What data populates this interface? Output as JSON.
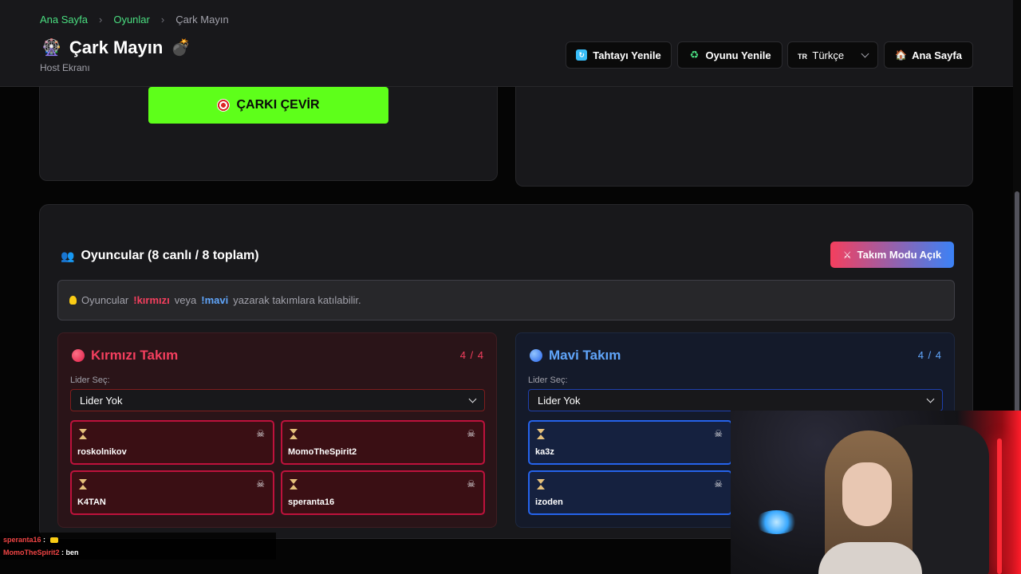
{
  "header": {
    "breadcrumb": {
      "home": "Ana Sayfa",
      "games": "Oyunlar",
      "current": "Çark Mayın"
    },
    "title": "Çark Mayın",
    "subtitle": "Host Ekranı",
    "buttons": {
      "refresh_board": "Tahtayı Yenile",
      "restart_game": "Oyunu Yenile",
      "language": "Türkçe",
      "language_code": "TR",
      "home": "Ana Sayfa"
    }
  },
  "wheel": {
    "spin_label": "ÇARKI ÇEVİR",
    "colors": {
      "left": "#2563eb",
      "right": "#b91c1c"
    }
  },
  "players": {
    "title": "Oyuncular (8 canlı / 8 toplam)",
    "team_mode_label": "Takım Modu Açık",
    "hint": {
      "prefix": "Oyuncular",
      "red_cmd": "!kırmızı",
      "mid": "veya",
      "blue_cmd": "!mavi",
      "suffix": "yazarak takımlara katılabilir."
    },
    "red_team": {
      "name": "Kırmızı Takım",
      "count": "4 / 4",
      "leader_label": "Lider Seç:",
      "leader_value": "Lider Yok",
      "members": [
        "roskolnikov",
        "MomoTheSpirit2",
        "K4TAN",
        "speranta16"
      ]
    },
    "blue_team": {
      "name": "Mavi Takım",
      "count": "4 / 4",
      "leader_label": "Lider Seç:",
      "leader_value": "Lider Yok",
      "members": [
        "ka3z",
        "izoden"
      ]
    }
  },
  "chat": [
    {
      "user": "speranta16",
      "message": ""
    },
    {
      "user": "MomoTheSpirit2",
      "message": "ben"
    }
  ],
  "accent_colors": {
    "green": "#4ade80",
    "spin": "#5eff1a",
    "red": "#f43f5e",
    "blue": "#60a5fa"
  }
}
